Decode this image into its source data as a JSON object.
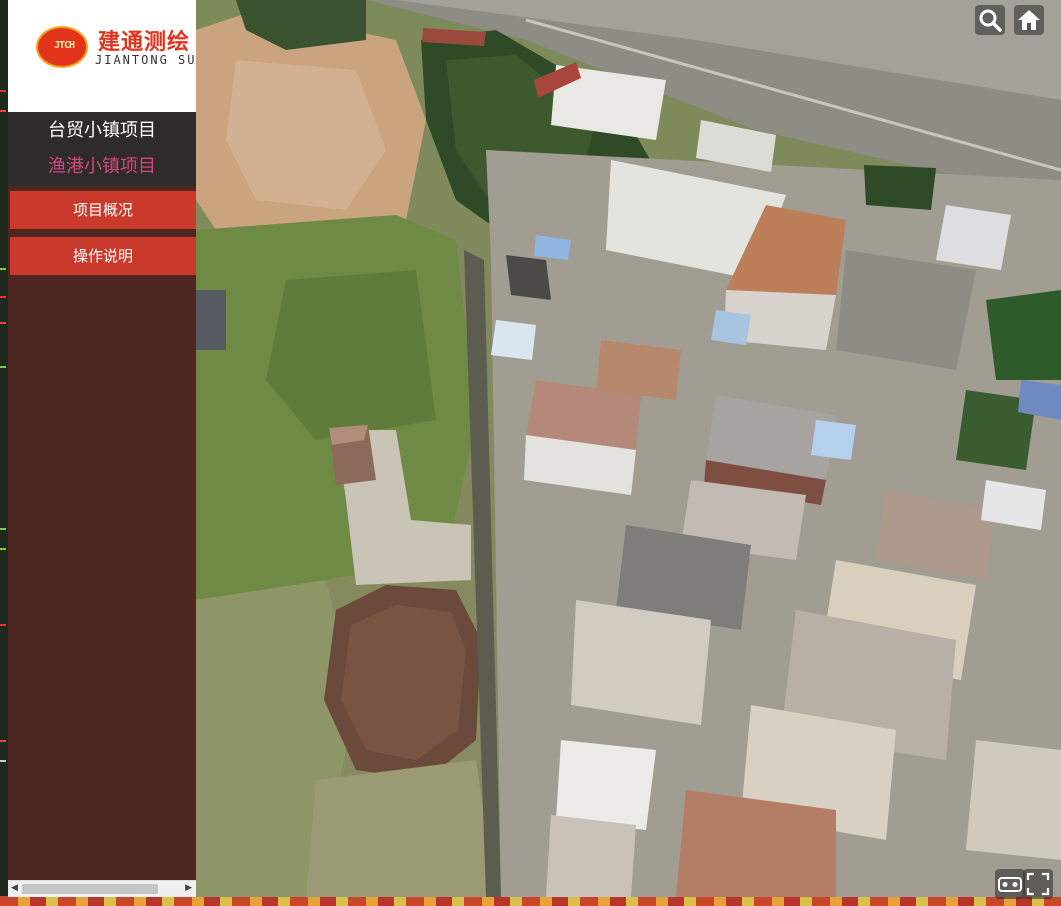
{
  "brand": {
    "name_cn": "建通测绘",
    "name_en": "JIANTONG SURVEYING",
    "emblem_text": "JTCH",
    "accent_color": "#e2341d"
  },
  "projects": [
    {
      "label": "台贸小镇项目",
      "color": "#ffffff"
    },
    {
      "label": "渔港小镇项目",
      "color": "#d24680"
    }
  ],
  "menu": {
    "overview_label": "项目概况",
    "instructions_label": "操作说明"
  },
  "controls": {
    "search": "search-icon",
    "home": "home-icon",
    "vr": "vr-goggles-icon",
    "fullscreen": "fullscreen-icon"
  },
  "colors": {
    "sidebar_bg": "#4f2721",
    "project_list_bg": "#2e2b2a",
    "button_bg": "#c93a2d"
  }
}
